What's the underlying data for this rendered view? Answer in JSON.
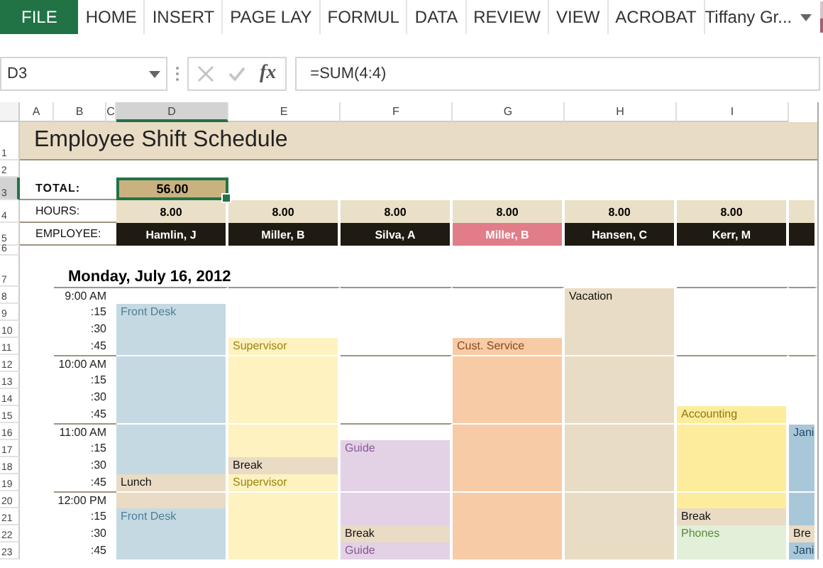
{
  "ribbon": {
    "tabs": [
      {
        "label": "FILE",
        "selected": true
      },
      {
        "label": "HOME",
        "selected": false
      },
      {
        "label": "INSERT",
        "selected": false
      },
      {
        "label": "PAGE LAY",
        "selected": false
      },
      {
        "label": "FORMUL",
        "selected": false
      },
      {
        "label": "DATA",
        "selected": false
      },
      {
        "label": "REVIEW",
        "selected": false
      },
      {
        "label": "VIEW",
        "selected": false
      },
      {
        "label": "ACROBAT",
        "selected": false
      }
    ],
    "user": "Tiffany Gr..."
  },
  "formula_bar": {
    "name_box": "D3",
    "function_symbol": "fx",
    "formula": "=SUM(4:4)"
  },
  "sheet": {
    "columns": [
      {
        "label": "A",
        "selected": false
      },
      {
        "label": "B",
        "selected": false
      },
      {
        "label": "C",
        "selected": false
      },
      {
        "label": "D",
        "selected": true
      },
      {
        "label": "E",
        "selected": false
      },
      {
        "label": "F",
        "selected": false
      },
      {
        "label": "G",
        "selected": false
      },
      {
        "label": "H",
        "selected": false
      },
      {
        "label": "I",
        "selected": false
      }
    ],
    "rows": [
      {
        "label": "1",
        "selected": false
      },
      {
        "label": "2",
        "selected": false
      },
      {
        "label": "3",
        "selected": true
      },
      {
        "label": "4",
        "selected": false
      },
      {
        "label": "5",
        "selected": false
      },
      {
        "label": "6",
        "selected": false
      },
      {
        "label": "7",
        "selected": false
      },
      {
        "label": "8",
        "selected": false
      },
      {
        "label": "9",
        "selected": false
      },
      {
        "label": "10",
        "selected": false
      },
      {
        "label": "11",
        "selected": false
      },
      {
        "label": "12",
        "selected": false
      },
      {
        "label": "13",
        "selected": false
      },
      {
        "label": "14",
        "selected": false
      },
      {
        "label": "15",
        "selected": false
      },
      {
        "label": "16",
        "selected": false
      },
      {
        "label": "17",
        "selected": false
      },
      {
        "label": "18",
        "selected": false
      },
      {
        "label": "19",
        "selected": false
      },
      {
        "label": "20",
        "selected": false
      },
      {
        "label": "21",
        "selected": false
      },
      {
        "label": "22",
        "selected": false
      },
      {
        "label": "23",
        "selected": false
      }
    ],
    "title": "Employee Shift Schedule",
    "total_label": "TOTAL:",
    "total": "56.00",
    "hours_label": "HOURS:",
    "employee_label": "EMPLOYEE:",
    "date": "Monday, July 16, 2012",
    "times": [
      "9:00 AM",
      ":15",
      ":30",
      ":45",
      "10:00 AM",
      ":15",
      ":30",
      ":45",
      "11:00 AM",
      ":15",
      ":30",
      ":45",
      "12:00 PM",
      ":15",
      ":30",
      ":45"
    ],
    "employees": [
      {
        "name": "Hamlin, J",
        "hours": "8.00",
        "highlight": false,
        "slots": [
          {
            "kind": "empty"
          },
          {
            "kind": "front-desk",
            "label": "Front Desk"
          },
          {
            "kind": "front-desk"
          },
          {
            "kind": "front-desk"
          },
          {
            "kind": "front-desk"
          },
          {
            "kind": "front-desk"
          },
          {
            "kind": "front-desk"
          },
          {
            "kind": "front-desk"
          },
          {
            "kind": "front-desk"
          },
          {
            "kind": "front-desk"
          },
          {
            "kind": "front-desk"
          },
          {
            "kind": "lunch",
            "label": "Lunch"
          },
          {
            "kind": "lunch"
          },
          {
            "kind": "front-desk",
            "label": "Front Desk"
          },
          {
            "kind": "front-desk"
          },
          {
            "kind": "front-desk"
          }
        ]
      },
      {
        "name": "Miller, B",
        "hours": "8.00",
        "highlight": false,
        "slots": [
          {
            "kind": "empty"
          },
          {
            "kind": "empty"
          },
          {
            "kind": "empty"
          },
          {
            "kind": "supervisor",
            "label": "Supervisor"
          },
          {
            "kind": "supervisor"
          },
          {
            "kind": "supervisor"
          },
          {
            "kind": "supervisor"
          },
          {
            "kind": "supervisor"
          },
          {
            "kind": "supervisor"
          },
          {
            "kind": "supervisor"
          },
          {
            "kind": "break",
            "label": "Break"
          },
          {
            "kind": "supervisor",
            "label": "Supervisor"
          },
          {
            "kind": "supervisor"
          },
          {
            "kind": "supervisor"
          },
          {
            "kind": "supervisor"
          },
          {
            "kind": "supervisor"
          }
        ]
      },
      {
        "name": "Silva, A",
        "hours": "8.00",
        "highlight": false,
        "slots": [
          {
            "kind": "empty"
          },
          {
            "kind": "empty"
          },
          {
            "kind": "empty"
          },
          {
            "kind": "empty"
          },
          {
            "kind": "empty"
          },
          {
            "kind": "empty"
          },
          {
            "kind": "empty"
          },
          {
            "kind": "empty"
          },
          {
            "kind": "empty"
          },
          {
            "kind": "guide",
            "label": "Guide"
          },
          {
            "kind": "guide"
          },
          {
            "kind": "guide"
          },
          {
            "kind": "guide"
          },
          {
            "kind": "guide"
          },
          {
            "kind": "break",
            "label": "Break"
          },
          {
            "kind": "guide",
            "label": "Guide"
          }
        ]
      },
      {
        "name": "Miller, B",
        "hours": "8.00",
        "highlight": true,
        "slots": [
          {
            "kind": "empty"
          },
          {
            "kind": "empty"
          },
          {
            "kind": "empty"
          },
          {
            "kind": "service",
            "label": "Cust. Service"
          },
          {
            "kind": "service"
          },
          {
            "kind": "service"
          },
          {
            "kind": "service"
          },
          {
            "kind": "service"
          },
          {
            "kind": "service"
          },
          {
            "kind": "service"
          },
          {
            "kind": "service"
          },
          {
            "kind": "service"
          },
          {
            "kind": "service"
          },
          {
            "kind": "service"
          },
          {
            "kind": "service"
          },
          {
            "kind": "service"
          }
        ]
      },
      {
        "name": "Hansen, C",
        "hours": "8.00",
        "highlight": false,
        "slots": [
          {
            "kind": "vacation",
            "label": "Vacation"
          },
          {
            "kind": "vacation"
          },
          {
            "kind": "vacation"
          },
          {
            "kind": "vacation"
          },
          {
            "kind": "vacation"
          },
          {
            "kind": "vacation"
          },
          {
            "kind": "vacation"
          },
          {
            "kind": "vacation"
          },
          {
            "kind": "vacation"
          },
          {
            "kind": "vacation"
          },
          {
            "kind": "vacation"
          },
          {
            "kind": "vacation"
          },
          {
            "kind": "vacation"
          },
          {
            "kind": "vacation"
          },
          {
            "kind": "vacation"
          },
          {
            "kind": "vacation"
          }
        ]
      },
      {
        "name": "Kerr, M",
        "hours": "8.00",
        "highlight": false,
        "slots": [
          {
            "kind": "empty"
          },
          {
            "kind": "empty"
          },
          {
            "kind": "empty"
          },
          {
            "kind": "empty"
          },
          {
            "kind": "empty"
          },
          {
            "kind": "empty"
          },
          {
            "kind": "empty"
          },
          {
            "kind": "accounting",
            "label": "Accounting"
          },
          {
            "kind": "accounting"
          },
          {
            "kind": "accounting"
          },
          {
            "kind": "accounting"
          },
          {
            "kind": "accounting"
          },
          {
            "kind": "accounting"
          },
          {
            "kind": "break",
            "label": "Break"
          },
          {
            "kind": "phones",
            "label": "Phones"
          },
          {
            "kind": "phones"
          }
        ]
      },
      {
        "highlight": false,
        "slots": [
          {
            "kind": "empty"
          },
          {
            "kind": "empty"
          },
          {
            "kind": "empty"
          },
          {
            "kind": "empty"
          },
          {
            "kind": "empty"
          },
          {
            "kind": "empty"
          },
          {
            "kind": "empty"
          },
          {
            "kind": "empty"
          },
          {
            "kind": "janitorial",
            "label": "Jani"
          },
          {
            "kind": "janitorial"
          },
          {
            "kind": "janitorial"
          },
          {
            "kind": "janitorial"
          },
          {
            "kind": "janitorial"
          },
          {
            "kind": "janitorial"
          },
          {
            "kind": "break",
            "label": "Bre"
          },
          {
            "kind": "janitorial",
            "label": "Jani"
          }
        ]
      }
    ]
  }
}
